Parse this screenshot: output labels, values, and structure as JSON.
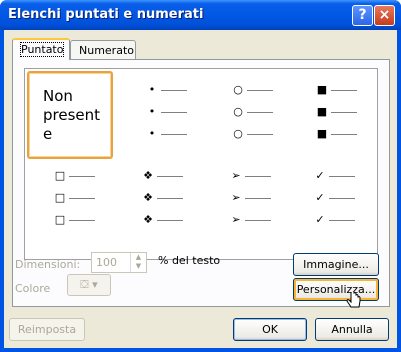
{
  "window": {
    "title": "Elenchi puntati e numerati",
    "help_glyph": "?",
    "close_glyph": "×"
  },
  "tabs": [
    {
      "label": "Puntato",
      "active": true
    },
    {
      "label": "Numerato",
      "active": false
    }
  ],
  "gallery": {
    "none_label": "Non present e",
    "rows": [
      [
        "none",
        "•",
        "○",
        "■"
      ],
      [
        "□",
        "❖",
        "➢",
        "✓"
      ]
    ]
  },
  "size": {
    "label": "Dimensioni:",
    "value": "100",
    "unit": "% del testo",
    "disabled": true
  },
  "color": {
    "label": "Colore",
    "disabled": true
  },
  "buttons": {
    "image": "Immagine...",
    "customize": "Personalizza...",
    "reset": "Reimposta",
    "ok": "OK",
    "cancel": "Annulla"
  }
}
